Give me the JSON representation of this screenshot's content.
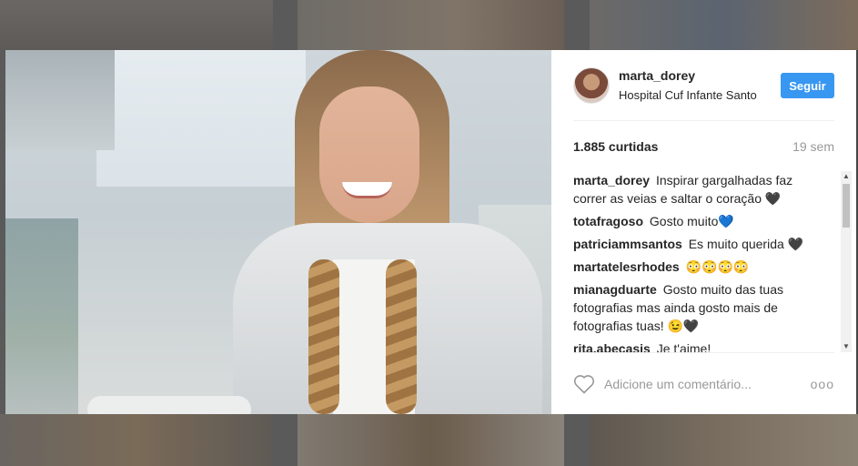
{
  "post": {
    "username": "marta_dorey",
    "location": "Hospital Cuf Infante Santo",
    "follow_label": "Seguir",
    "likes": "1.885 curtidas",
    "time_ago": "19 sem"
  },
  "comments": [
    {
      "user": "marta_dorey",
      "text": "Inspirar gargalhadas faz correr as veias e saltar o coração 🖤"
    },
    {
      "user": "totafragoso",
      "text": "Gosto muito💙"
    },
    {
      "user": "patriciammsantos",
      "text": "Es muito querida 🖤"
    },
    {
      "user": "martatelesrhodes",
      "text": "😳😳😳😳"
    },
    {
      "user": "mianagduarte",
      "text": "Gosto muito das tuas fotografias mas ainda gosto mais de fotografias tuas! 😉🖤"
    },
    {
      "user": "rita.abecasis",
      "text": "Je t'aime!"
    }
  ],
  "comment_box": {
    "placeholder": "Adicione um comentário...",
    "more_label": "ooo"
  },
  "icons": [
    "heart-outline-icon",
    "more-options-icon",
    "scroll-up-arrow-icon",
    "scroll-down-arrow-icon"
  ],
  "colors": {
    "follow_button": "#3897f0",
    "muted_text": "#999999",
    "text": "#262626"
  }
}
